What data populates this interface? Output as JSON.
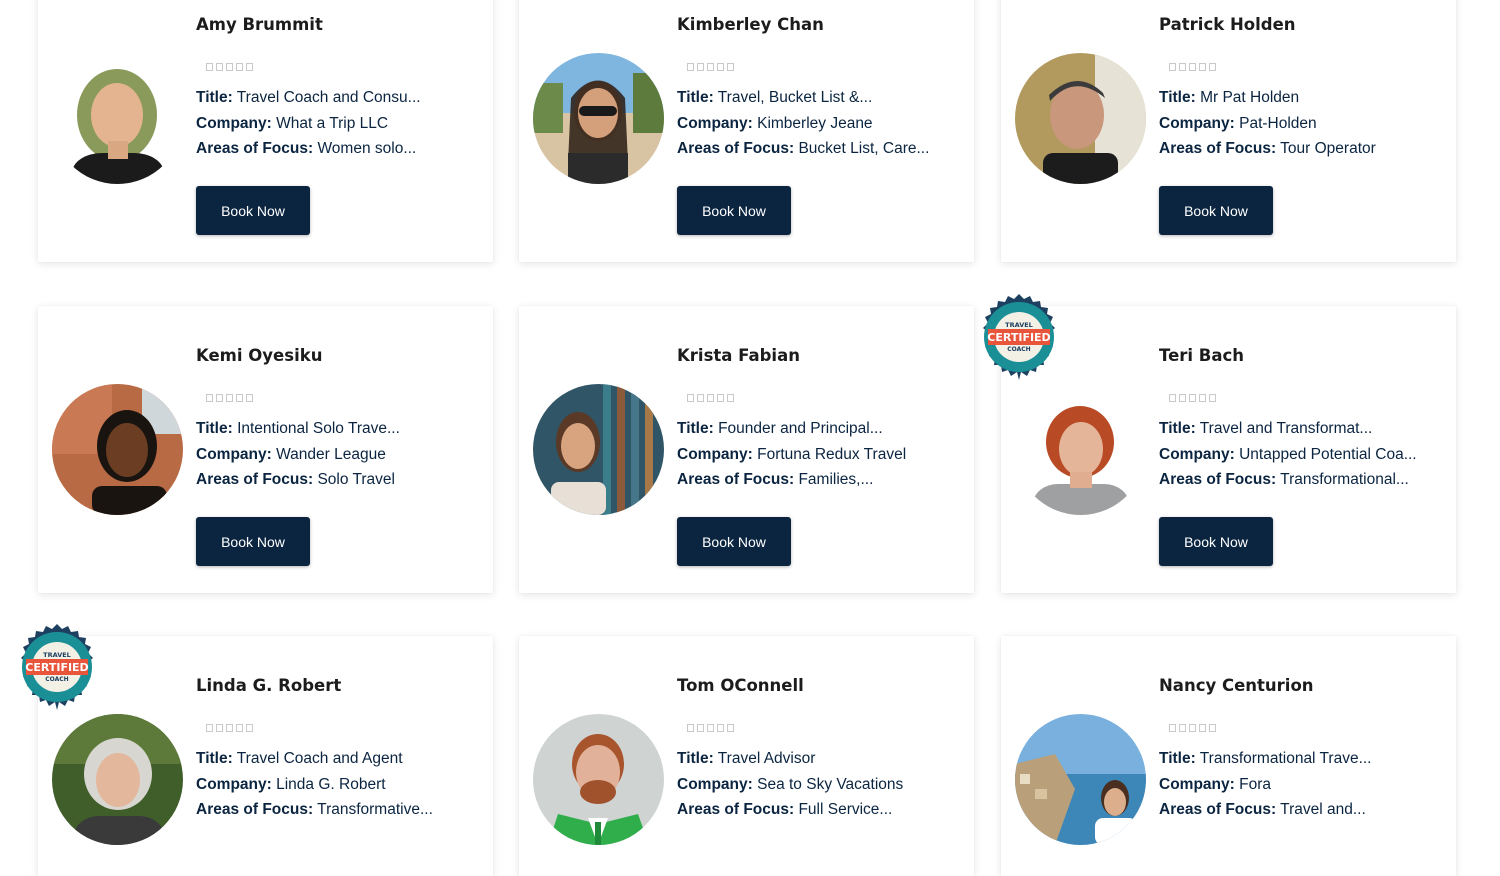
{
  "labels": {
    "title": "Title:",
    "company": "Company:",
    "areas": "Areas of Focus:",
    "book": "Book Now"
  },
  "badge": {
    "top_line": "TRAVEL",
    "main": "CERTIFIED",
    "bottom_line": "COACH",
    "colors": {
      "ring": "#1b8f96",
      "center": "#e8553a",
      "edge": "#1d4060"
    }
  },
  "colors": {
    "navy": "#0b2541",
    "name": "#1c1c1c",
    "star_outline": "#c9c9c9"
  },
  "coaches": [
    {
      "name": "Amy Brummit",
      "title": "Travel Coach and Consu...",
      "company": "What a Trip LLC",
      "areas": "Women solo...",
      "rating": 0,
      "certified": false
    },
    {
      "name": "Kimberley Chan",
      "title": "Travel, Bucket List &...",
      "company": "Kimberley Jeane",
      "areas": "Bucket List, Care...",
      "rating": 0,
      "certified": false
    },
    {
      "name": "Patrick Holden",
      "title": "Mr Pat Holden",
      "company": "Pat-Holden",
      "areas": "Tour Operator",
      "rating": 0,
      "certified": false
    },
    {
      "name": "Kemi Oyesiku",
      "title": "Intentional Solo Trave...",
      "company": "Wander League",
      "areas": "Solo Travel",
      "rating": 0,
      "certified": false
    },
    {
      "name": "Krista Fabian",
      "title": "Founder and Principal...",
      "company": "Fortuna Redux Travel",
      "areas": "Families,...",
      "rating": 0,
      "certified": false
    },
    {
      "name": "Teri Bach",
      "title": "Travel and Transformat...",
      "company": "Untapped Potential Coa...",
      "areas": "Transformational...",
      "rating": 0,
      "certified": true
    },
    {
      "name": "Linda G. Robert",
      "title": "Travel Coach and Agent",
      "company": "Linda G. Robert",
      "areas": "Transformative...",
      "rating": 0,
      "certified": true
    },
    {
      "name": "Tom OConnell",
      "title": "Travel Advisor",
      "company": "Sea to Sky Vacations",
      "areas": "Full Service...",
      "rating": 0,
      "certified": false
    },
    {
      "name": "Nancy Centurion",
      "title": "Transformational Trave...",
      "company": "Fora",
      "areas": "Travel and...",
      "rating": 0,
      "certified": false
    }
  ]
}
